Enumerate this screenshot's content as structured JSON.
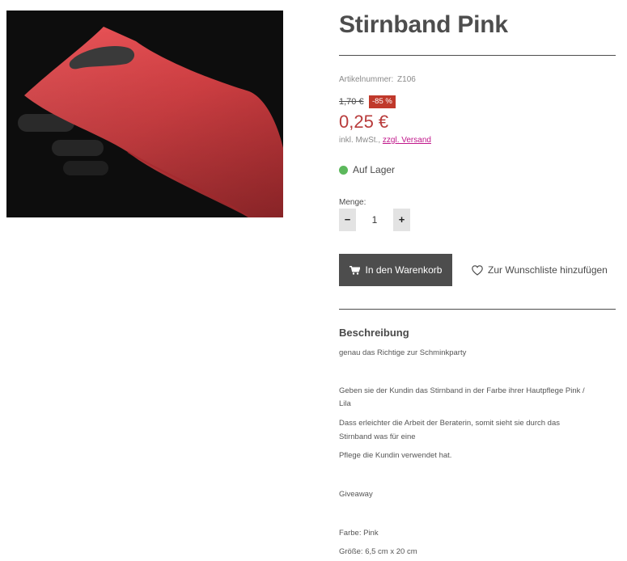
{
  "product": {
    "title": "Stirnband Pink",
    "sku_label": "Artikelnummer:",
    "sku_value": "Z106",
    "old_price": "1,70 €",
    "discount": "-85 %",
    "price": "0,25 €",
    "tax_note": "inkl. MwSt.,",
    "shipping_link": "zzgl. Versand",
    "stock_status": "Auf Lager",
    "stock_color": "#5cb85c",
    "price_color": "#b83b3b"
  },
  "quantity": {
    "label": "Menge:",
    "minus": "−",
    "value": "1",
    "plus": "+"
  },
  "actions": {
    "add_to_cart": "In den Warenkorb",
    "wishlist": "Zur Wunschliste hinzufügen"
  },
  "description": {
    "heading": "Beschreibung",
    "lines": [
      "genau das Richtige zur Schminkparty",
      "Geben sie der Kundin das Stirnband in der Farbe ihrer Hautpflege Pink /",
      "Lila",
      "Dass erleichter die Arbeit der Beraterin, somit sieht sie durch das",
      "Stirnband was für eine",
      "Pflege die Kundin verwendet hat.",
      "Giveaway",
      "Farbe: Pink",
      "Größe: 6,5 cm x 20 cm"
    ]
  },
  "icons": {
    "cart": "shopping-cart-icon",
    "wishlist": "heart-icon",
    "stock": "status-dot-icon"
  }
}
